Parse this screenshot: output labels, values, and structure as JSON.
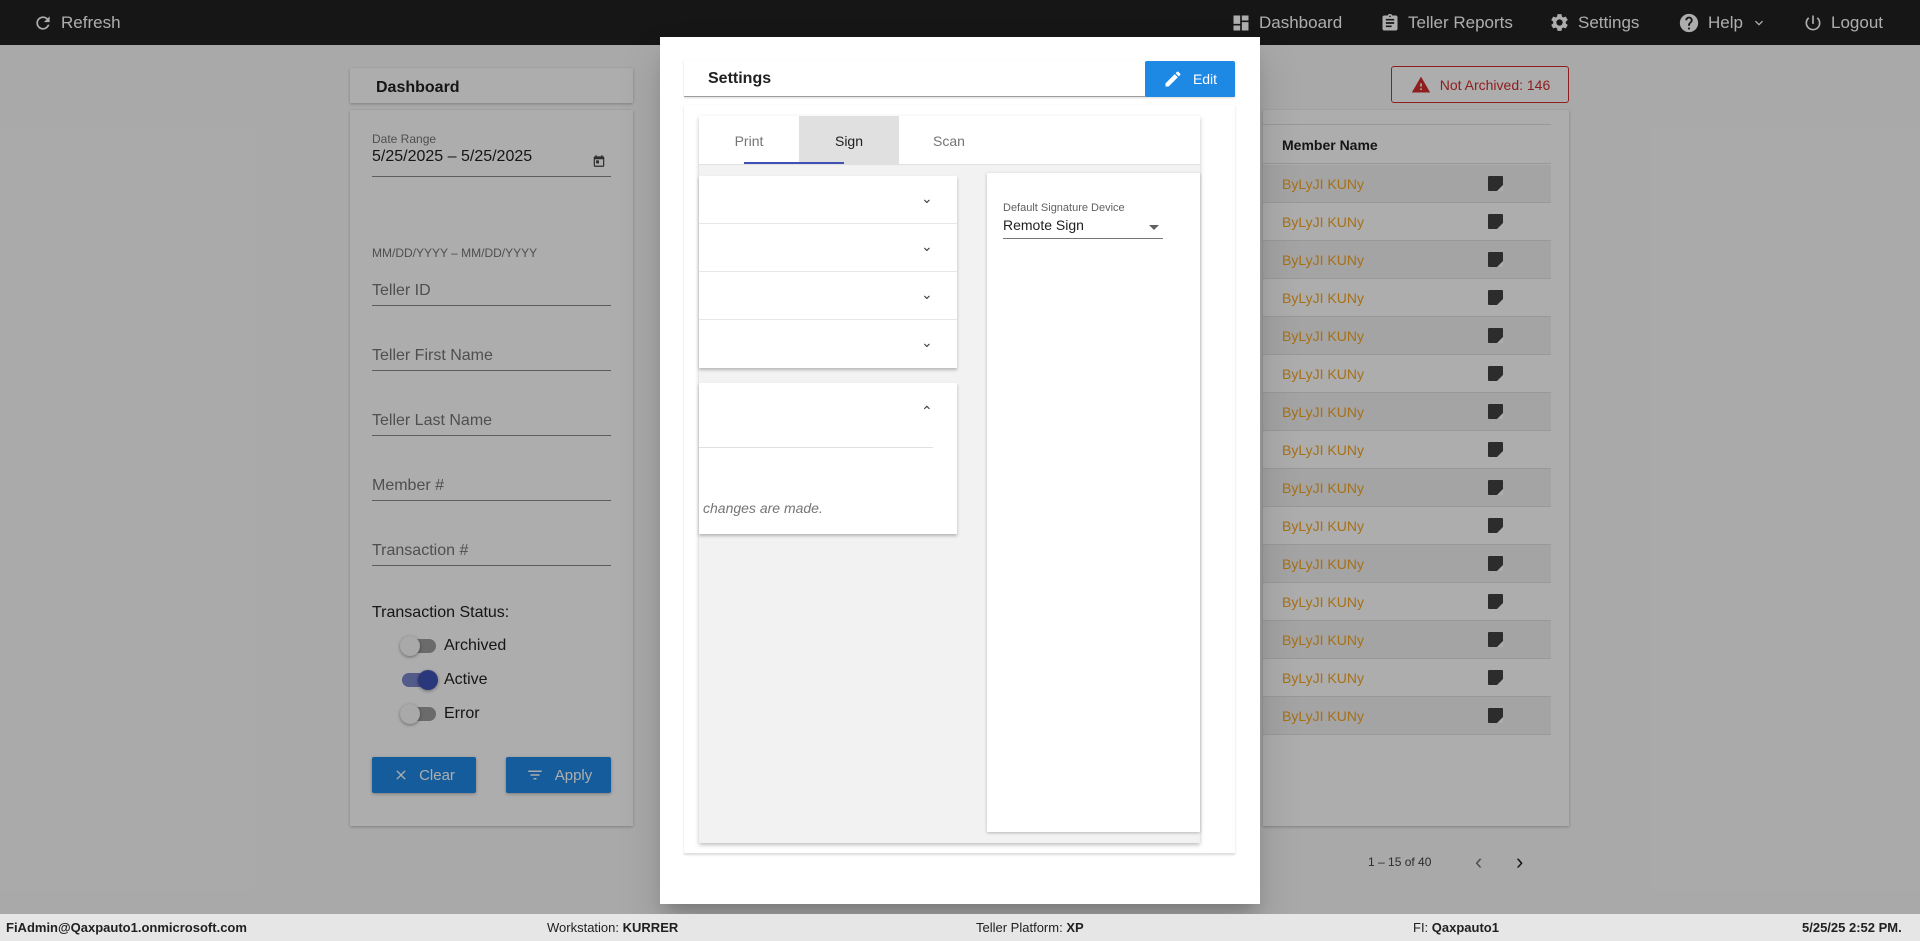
{
  "topbar": {
    "refresh": "Refresh",
    "dashboard": "Dashboard",
    "teller_reports": "Teller Reports",
    "settings": "Settings",
    "help": "Help",
    "logout": "Logout"
  },
  "dashboard": {
    "title": "Dashboard",
    "not_archived": "Not Archived: 146",
    "filters": {
      "date_range_label": "Date Range",
      "date_range_value": "5/25/2025 – 5/25/2025",
      "date_hint": "MM/DD/YYYY – MM/DD/YYYY",
      "teller_id": "Teller ID",
      "teller_first_name": "Teller First Name",
      "teller_last_name": "Teller Last Name",
      "member_number": "Member #",
      "transaction_number": "Transaction #",
      "transaction_status": "Transaction Status:",
      "statuses": [
        {
          "label": "Archived",
          "on": false
        },
        {
          "label": "Active",
          "on": true
        },
        {
          "label": "Error",
          "on": false
        }
      ],
      "clear": "Clear",
      "apply": "Apply"
    },
    "table": {
      "column_member_name": "Member Name",
      "rows": [
        "ByLyJI KUNy",
        "ByLyJI KUNy",
        "ByLyJI KUNy",
        "ByLyJI KUNy",
        "ByLyJI KUNy",
        "ByLyJI KUNy",
        "ByLyJI KUNy",
        "ByLyJI KUNy",
        "ByLyJI KUNy",
        "ByLyJI KUNy",
        "ByLyJI KUNy",
        "ByLyJI KUNy",
        "ByLyJI KUNy",
        "ByLyJI KUNy",
        "ByLyJI KUNy"
      ],
      "pagination": "1 – 15 of 40"
    }
  },
  "modal": {
    "title": "Settings",
    "edit": "Edit",
    "tabs": [
      "Print",
      "Sign",
      "Scan"
    ],
    "active_tab": "Sign",
    "panel_note": "changes are made.",
    "signature_device_label": "Default Signature Device",
    "signature_device_value": "Remote Sign"
  },
  "footer": {
    "user": "FiAdmin@Qaxpauto1.onmicrosoft.com",
    "workstation_label": "Workstation:",
    "workstation": "KURRER",
    "platform_label": "Teller Platform:",
    "platform": "XP",
    "fi_label": "FI:",
    "fi": "Qaxpauto1",
    "datetime": "5/25/25 2:52 PM."
  },
  "colors": {
    "primary": "#1e88e5",
    "toggle_on": "#3f51b5",
    "member_name": "#f5a623",
    "alert": "#d32f2f"
  }
}
